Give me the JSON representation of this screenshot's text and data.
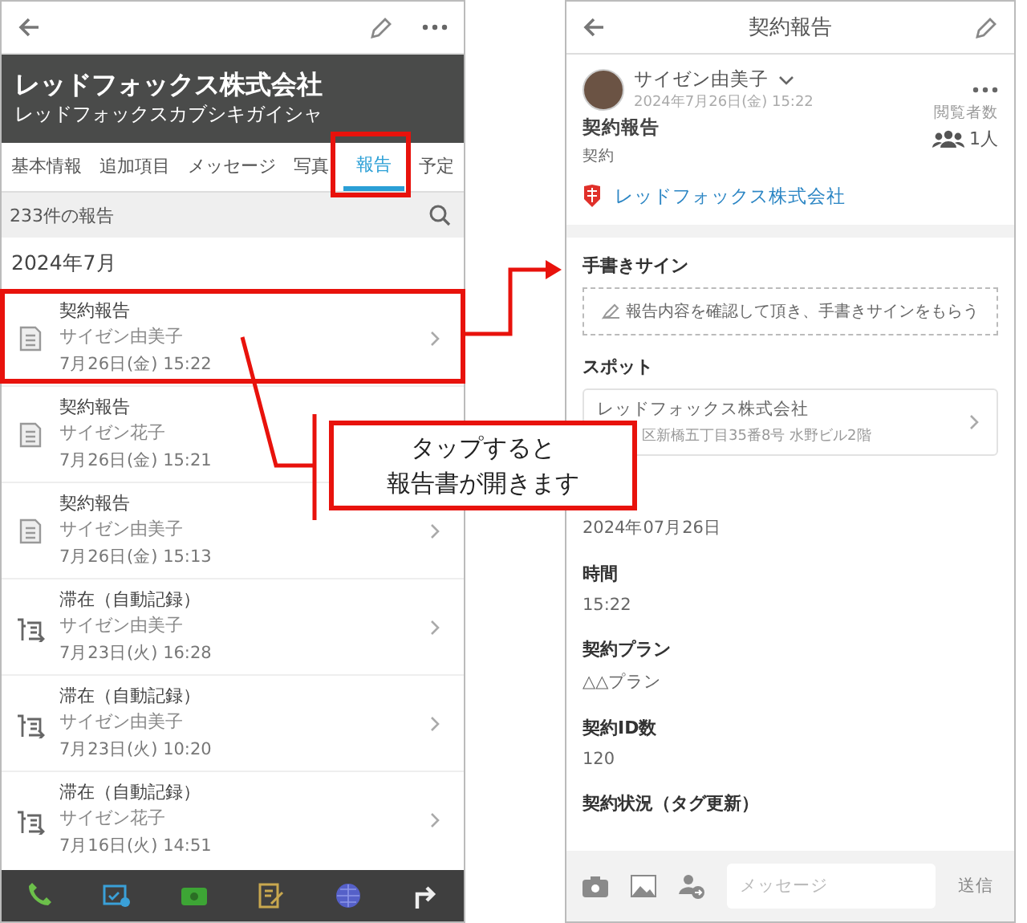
{
  "left_screen": {
    "company": {
      "name": "レッドフォックス株式会社",
      "kana": "レッドフォックスカブシキガイシャ"
    },
    "tabs": [
      {
        "label": "基本情報",
        "selected": false
      },
      {
        "label": "追加項目",
        "selected": false
      },
      {
        "label": "メッセージ",
        "selected": false
      },
      {
        "label": "写真",
        "selected": false
      },
      {
        "label": "報告",
        "selected": true
      },
      {
        "label": "予定",
        "selected": false
      }
    ],
    "report_count": "233件の報告",
    "month": "2024年7月",
    "reports": [
      {
        "kind": "contract",
        "title": "契約報告",
        "author": "サイゼン由美子",
        "datetime": "7月26日(金) 15:22"
      },
      {
        "kind": "contract",
        "title": "契約報告",
        "author": "サイゼン花子",
        "datetime": "7月26日(金) 15:21"
      },
      {
        "kind": "contract",
        "title": "契約報告",
        "author": "サイゼン由美子",
        "datetime": "7月26日(金) 15:13"
      },
      {
        "kind": "stay",
        "title": "滞在（自動記録）",
        "author": "サイゼン由美子",
        "datetime": "7月23日(火) 16:28"
      },
      {
        "kind": "stay",
        "title": "滞在（自動記録）",
        "author": "サイゼン由美子",
        "datetime": "7月23日(火) 10:20"
      },
      {
        "kind": "stay",
        "title": "滞在（自動記録）",
        "author": "サイゼン花子",
        "datetime": "7月16日(火) 14:51"
      }
    ]
  },
  "right_screen": {
    "title": "契約報告",
    "author": "サイゼン由美子",
    "posted": "2024年7月26日(金) 15:22",
    "viewers_label": "閲覧者数",
    "viewers": "1人",
    "report_type": "契約報告",
    "category": "契約",
    "company_link": "レッドフォックス株式会社",
    "signature": {
      "label": "手書きサイン",
      "prompt": "報告内容を確認して頂き、手書きサインをもらう"
    },
    "spot": {
      "label": "スポット",
      "name": "レッドフォックス株式会社",
      "address": "区新橋五丁目35番8号 水野ビル2階"
    },
    "fields": [
      {
        "value": "2024年07月26日"
      },
      {
        "label": "時間",
        "value": "15:22"
      },
      {
        "label": "契約プラン",
        "value": "△△プラン"
      },
      {
        "label": "契約ID数",
        "value": "120"
      },
      {
        "label": "契約状況（タグ更新）"
      }
    ],
    "message_placeholder": "メッセージ",
    "send_label": "送信"
  },
  "annotation": {
    "lines": [
      "タップすると",
      "報告書が開きます"
    ]
  }
}
